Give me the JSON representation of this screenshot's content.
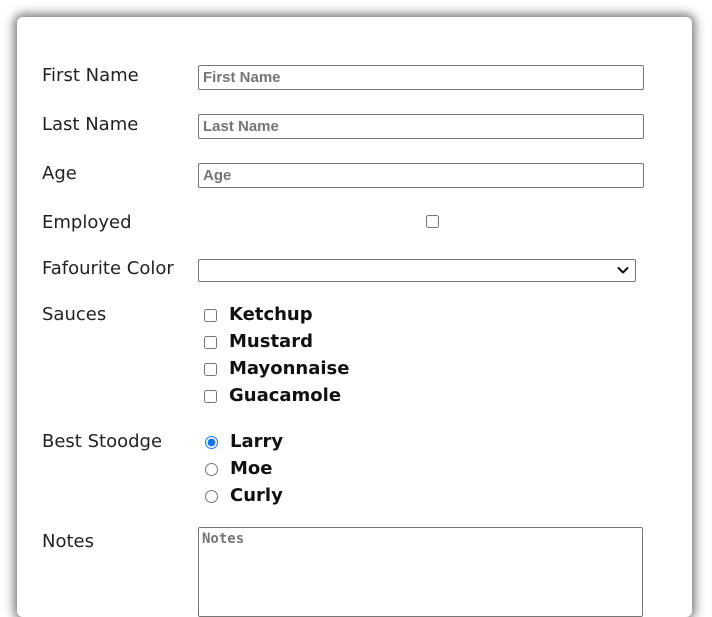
{
  "form": {
    "first_name": {
      "label": "First Name",
      "placeholder": "First Name",
      "value": ""
    },
    "last_name": {
      "label": "Last Name",
      "placeholder": "Last Name",
      "value": ""
    },
    "age": {
      "label": "Age",
      "placeholder": "Age",
      "value": ""
    },
    "employed": {
      "label": "Employed",
      "checked": false
    },
    "favourite_color": {
      "label": "Fafourite Color",
      "selected": ""
    },
    "sauces": {
      "label": "Sauces",
      "options": [
        {
          "label": "Ketchup",
          "checked": false
        },
        {
          "label": "Mustard",
          "checked": false
        },
        {
          "label": "Mayonnaise",
          "checked": false
        },
        {
          "label": "Guacamole",
          "checked": false
        }
      ]
    },
    "best_stooge": {
      "label": "Best Stoodge",
      "options": [
        {
          "label": "Larry",
          "checked": true
        },
        {
          "label": "Moe",
          "checked": false
        },
        {
          "label": "Curly",
          "checked": false
        }
      ]
    },
    "notes": {
      "label": "Notes",
      "placeholder": "Notes",
      "value": ""
    }
  },
  "colors": {
    "accent": "#1a73e8",
    "border": "#767676",
    "placeholder": "#757575"
  },
  "icons": {
    "select_arrow": "chevron-down-icon"
  }
}
